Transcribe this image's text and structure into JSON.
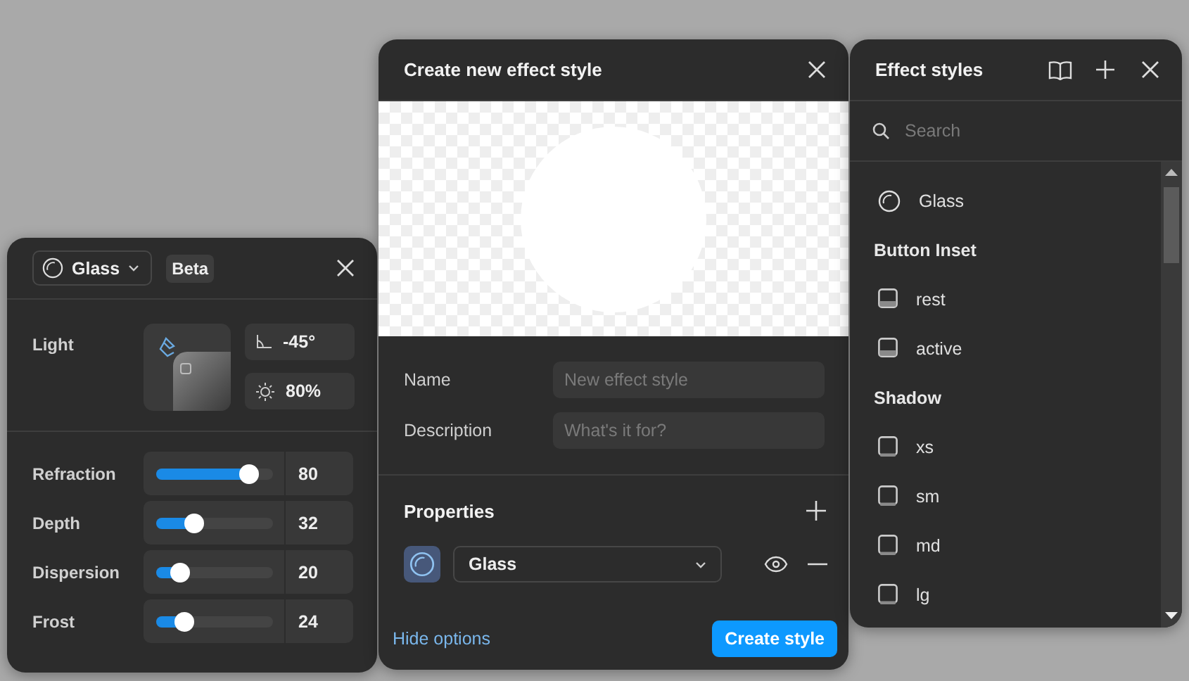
{
  "glass_panel": {
    "effect_select": "Glass",
    "badge": "Beta",
    "light": {
      "label": "Light",
      "angle": "-45°",
      "intensity": "80%"
    },
    "sliders": [
      {
        "label": "Refraction",
        "level": 0.8,
        "value": "80"
      },
      {
        "label": "Depth",
        "level": 0.32,
        "value": "32"
      },
      {
        "label": "Dispersion",
        "level": 0.2,
        "value": "20"
      },
      {
        "label": "Frost",
        "level": 0.24,
        "value": "24"
      }
    ]
  },
  "create_dialog": {
    "title": "Create new effect style",
    "fields": [
      {
        "label": "Name",
        "placeholder": "New effect style"
      },
      {
        "label": "Description",
        "placeholder": "What's it for?"
      }
    ],
    "properties_title": "Properties",
    "properties": [
      {
        "effect": "Glass",
        "visible": true
      }
    ],
    "hide_options": "Hide options",
    "create_button": "Create style"
  },
  "effect_styles": {
    "title": "Effect styles",
    "search_placeholder": "Search",
    "items": [
      {
        "kind": "glass",
        "label": "Glass"
      },
      {
        "kind": "group",
        "label": "Button Inset"
      },
      {
        "kind": "inset",
        "label": "rest"
      },
      {
        "kind": "inset",
        "label": "active"
      },
      {
        "kind": "group",
        "label": "Shadow"
      },
      {
        "kind": "shadow",
        "label": "xs"
      },
      {
        "kind": "shadow",
        "label": "sm"
      },
      {
        "kind": "shadow",
        "label": "md"
      },
      {
        "kind": "shadow",
        "label": "lg"
      }
    ]
  }
}
